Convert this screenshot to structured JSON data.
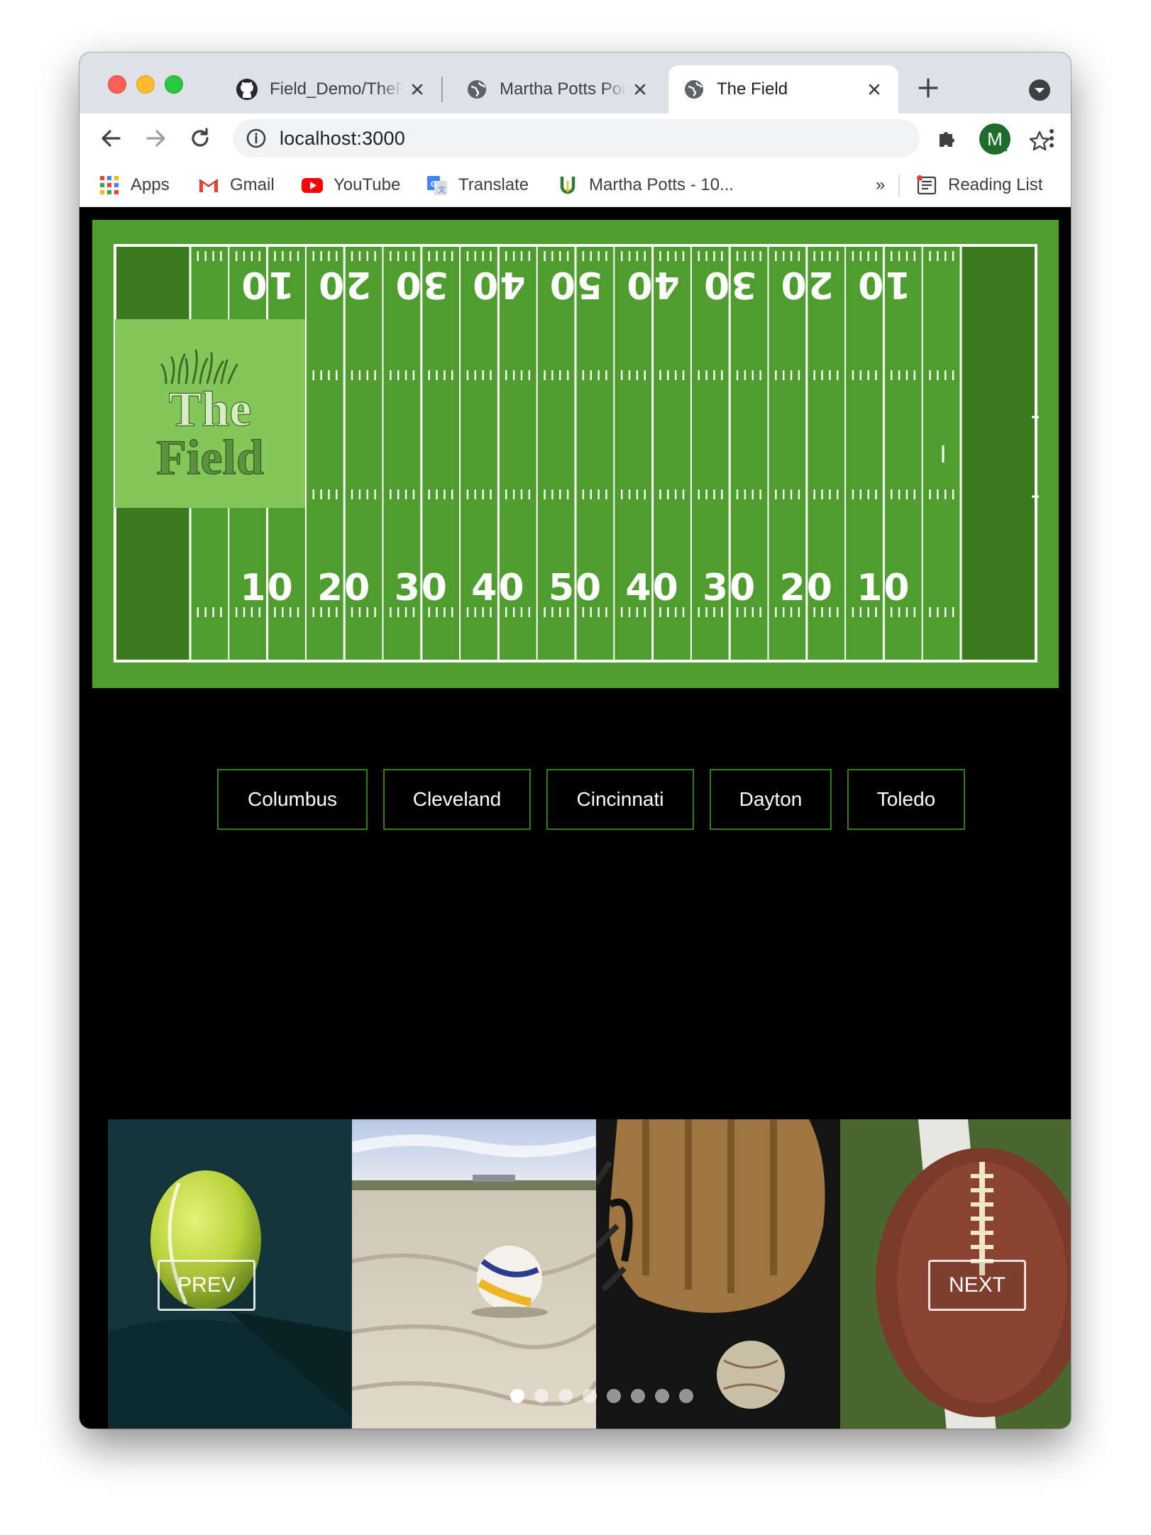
{
  "browser": {
    "tabs": [
      {
        "title": "Field_Demo/TheField",
        "favicon": "github-icon"
      },
      {
        "title": "Martha Potts Portfolio",
        "favicon": "globe-icon"
      },
      {
        "title": "The Field",
        "favicon": "globe-icon",
        "active": true
      }
    ],
    "url": "localhost:3000",
    "profile_initial": "M",
    "bookmarks": [
      {
        "label": "Apps",
        "icon": "apps-grid-icon"
      },
      {
        "label": "Gmail",
        "icon": "gmail-icon"
      },
      {
        "label": "YouTube",
        "icon": "youtube-icon"
      },
      {
        "label": "Translate",
        "icon": "translate-icon"
      },
      {
        "label": "Martha Potts - 10...",
        "icon": "horseshoe-icon"
      }
    ],
    "overflow_label": "»",
    "reading_list_label": "Reading List"
  },
  "hero": {
    "logo_line1": "The",
    "logo_line2": "Field",
    "yard_numbers_bottom": [
      "10",
      "20",
      "30",
      "40",
      "50",
      "40",
      "30",
      "20",
      "10"
    ],
    "yard_numbers_top": [
      "10",
      "20",
      "30",
      "40",
      "50",
      "40",
      "30",
      "20",
      "10"
    ],
    "colors": {
      "field": "#4f9d2e",
      "endzone": "#3b7a1f",
      "logo_box": "#83c65a"
    }
  },
  "cities": [
    "Columbus",
    "Cleveland",
    "Cincinnati",
    "Dayton",
    "Toledo"
  ],
  "carousel": {
    "prev_label": "PREV",
    "next_label": "NEXT",
    "slides": [
      "tennis-ball-image",
      "volleyball-beach-image",
      "baseball-glove-image",
      "football-on-grass-image"
    ],
    "dot_count": 8,
    "active_dot": 0
  }
}
